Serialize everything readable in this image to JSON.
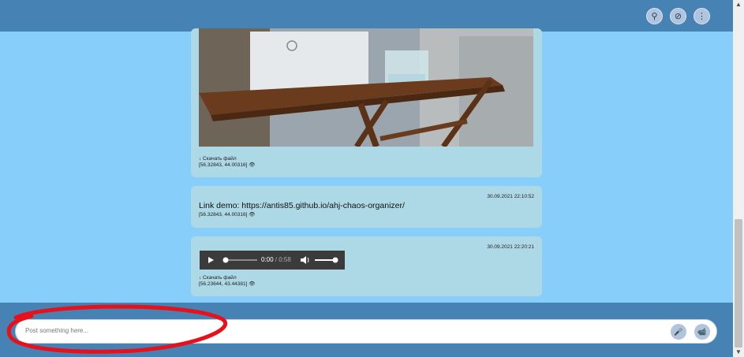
{
  "header": {
    "buttons": [
      {
        "icon": "search-icon",
        "glyph": "⚲"
      },
      {
        "icon": "attach-icon",
        "glyph": "⊘"
      },
      {
        "icon": "menu-icon",
        "glyph": "⋮"
      }
    ]
  },
  "messages": [
    {
      "type": "image",
      "download_label": "↓ Скачать файл",
      "coords": "[56.32843, 44.00316] 👁"
    },
    {
      "type": "link",
      "date": "30.09.2021 22:10:52",
      "text": "Link demo: https://antis85.github.io/ahj-chaos-organizer/",
      "coords": "[56.32843, 44.00316] 👁"
    },
    {
      "type": "audio",
      "date": "30.09.2021 22:20:21",
      "player": {
        "current": "0:00",
        "separator": " / ",
        "duration": "0:58"
      },
      "download_label": "↓ Скачать файл",
      "coords": "[56.23644, 43.44381] 👁"
    }
  ],
  "composer": {
    "placeholder": "Post something here...",
    "mic_glyph": "🎤",
    "camera_glyph": "📹"
  },
  "colors": {
    "background": "#87cefa",
    "bars": "#4682b4",
    "card": "#add8e6",
    "annotation": "#e8101a"
  }
}
